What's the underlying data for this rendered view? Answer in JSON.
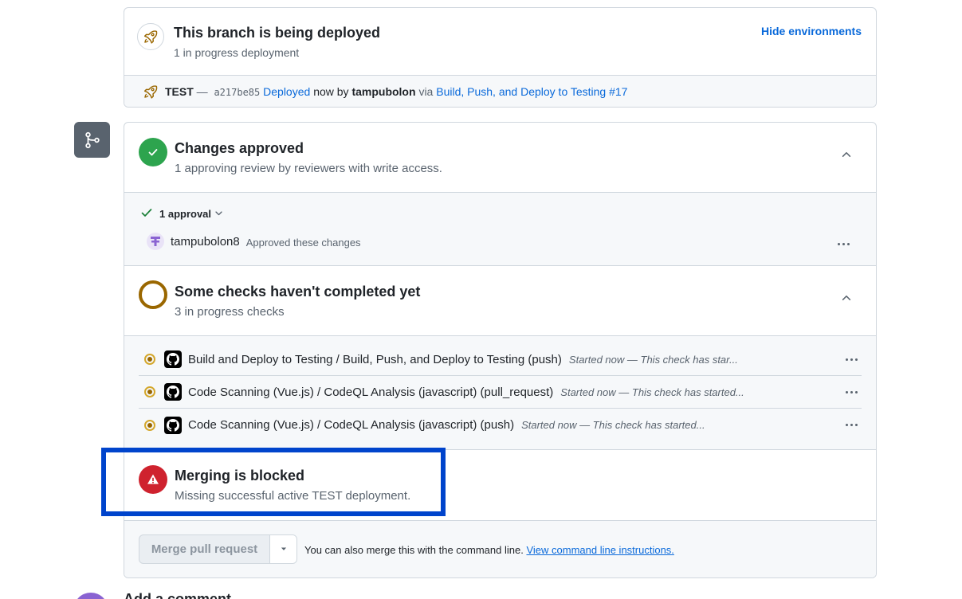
{
  "deploy": {
    "title": "This branch is being deployed",
    "subtitle": "1 in progress deployment",
    "hide_link": "Hide environments",
    "row": {
      "env": "TEST",
      "dash": "—",
      "sha": "a217be85",
      "status_link": "Deployed",
      "now_by": "now by",
      "user": "tampubolon",
      "via": "via",
      "workflow_link": "Build, Push, and Deploy to Testing #17"
    }
  },
  "approval": {
    "title": "Changes approved",
    "subtitle": "1 approving review by reviewers with write access.",
    "toggle_label": "1 approval",
    "reviewer": "tampubolon8",
    "reviewer_note": "Approved these changes"
  },
  "checks": {
    "title": "Some checks haven't completed yet",
    "subtitle": "3 in progress checks",
    "items": [
      {
        "name": "Build and Deploy to Testing / Build, Push, and Deploy to Testing (push)",
        "note": "Started now — This check has star..."
      },
      {
        "name": "Code Scanning (Vue.js) / CodeQL Analysis (javascript) (pull_request)",
        "note": "Started now — This check has started..."
      },
      {
        "name": "Code Scanning (Vue.js) / CodeQL Analysis (javascript) (push)",
        "note": "Started now — This check has started..."
      }
    ]
  },
  "blocked": {
    "title": "Merging is blocked",
    "subtitle": "Missing successful active TEST deployment."
  },
  "merge": {
    "button_label": "Merge pull request",
    "hint_text": "You can also merge this with the command line.",
    "hint_link": "View command line instructions."
  },
  "comment": {
    "title": "Add a comment"
  },
  "colors": {
    "success": "#2da44e",
    "danger": "#cf222e",
    "pending": "#9a6700",
    "link": "#0969da",
    "highlight": "#0044cc"
  }
}
